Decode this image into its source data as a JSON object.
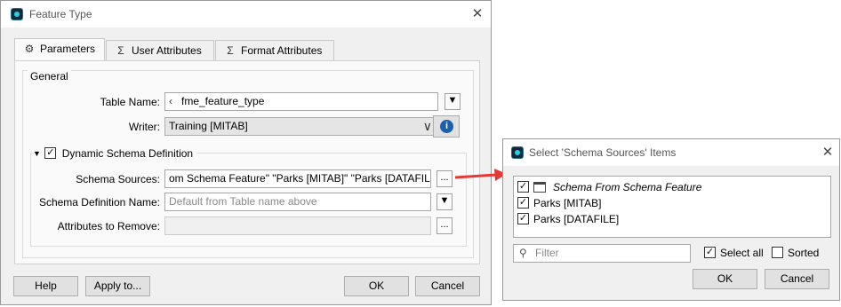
{
  "feature_type_dialog": {
    "title": "Feature Type",
    "tabs": [
      {
        "label": "Parameters",
        "icon": "gear-icon"
      },
      {
        "label": "User Attributes",
        "icon": "sigma-tag-icon"
      },
      {
        "label": "Format Attributes",
        "icon": "sigma-tag-icon"
      }
    ],
    "general_group": {
      "title": "General",
      "table_name_label": "Table Name:",
      "table_name_value": "fme_feature_type",
      "writer_label": "Writer:",
      "writer_value": "Training [MITAB]",
      "info_icon": "info-icon"
    },
    "dynamic_schema": {
      "title": "Dynamic Schema Definition",
      "checked": true,
      "schema_sources_label": "Schema Sources:",
      "schema_sources_value": "om Schema Feature\" \"Parks [MITAB]\" \"Parks [DATAFILE]\"",
      "schema_definition_label": "Schema Definition Name:",
      "schema_definition_placeholder": "Default from Table name above",
      "attributes_remove_label": "Attributes to Remove:",
      "ellipsis": "..."
    },
    "buttons": {
      "help": "Help",
      "apply_to": "Apply to...",
      "ok": "OK",
      "cancel": "Cancel"
    }
  },
  "select_dialog": {
    "title": "Select 'Schema Sources' Items",
    "items": [
      {
        "label": "Schema From Schema Feature",
        "checked": true,
        "italic": true
      },
      {
        "label": "Parks [MITAB]",
        "checked": true,
        "italic": false
      },
      {
        "label": "Parks [DATAFILE]",
        "checked": true,
        "italic": false
      }
    ],
    "filter_placeholder": "Filter",
    "select_all_label": "Select all",
    "select_all_checked": true,
    "sorted_label": "Sorted",
    "sorted_checked": false,
    "ok": "OK",
    "cancel": "Cancel"
  },
  "colors": {
    "arrow": "#e53935",
    "info": "#1a5fb4"
  }
}
